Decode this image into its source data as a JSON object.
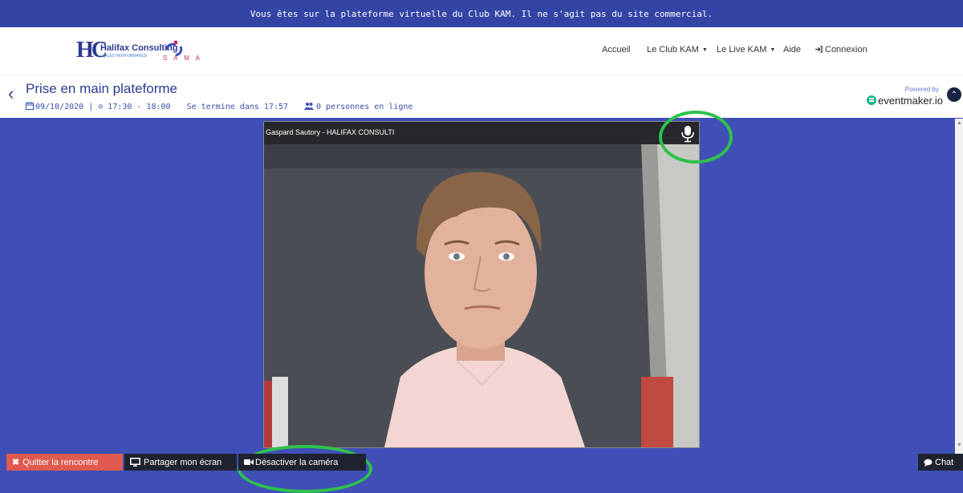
{
  "banner": {
    "text": "Vous êtes sur la plateforme virtuelle du Club KAM. Il ne s'agit pas du site commercial."
  },
  "logo": {
    "initials": "HC",
    "name": "Halifax Consulting",
    "tagline": "SALES PERFORMANCE",
    "partner": "S A M A"
  },
  "nav": {
    "home": "Accueil",
    "club": "Le Club KAM",
    "live": "Le Live KAM",
    "help": "Aide",
    "login": "Connexion"
  },
  "event": {
    "title": "Prise en main plateforme",
    "date_time": "09/10/2020 | ⊙ 17:30 - 18:00",
    "ends_in": "Se termine dans 17:57",
    "online": "0 personnes en ligne"
  },
  "powered": {
    "label": "Powered by",
    "brand": "eventmaker.io"
  },
  "video": {
    "participant": "Gaspard Sautory - HALIFAX CONSULTI"
  },
  "actions": {
    "quit": "Quitter la rencontre",
    "share": "Partager mon écran",
    "camera": "Désactiver la caméra",
    "chat": "Chat"
  },
  "colors": {
    "background": "#3f4fb5",
    "banner": "#3344a5",
    "brand": "#2c3a92",
    "quit": "#e05a4f",
    "dark_button": "#1f2330",
    "highlight": "#2ec24b",
    "eventmaker": "#1db38a"
  },
  "icons": {
    "back": "chevron-left-icon",
    "calendar": "calendar-icon",
    "users": "users-icon",
    "login": "sign-in-icon",
    "microphone": "microphone-icon",
    "quit": "close-icon",
    "share": "monitor-icon",
    "camera": "video-camera-icon",
    "chat": "chat-bubble-icon",
    "collapse": "chevron-up-icon"
  }
}
